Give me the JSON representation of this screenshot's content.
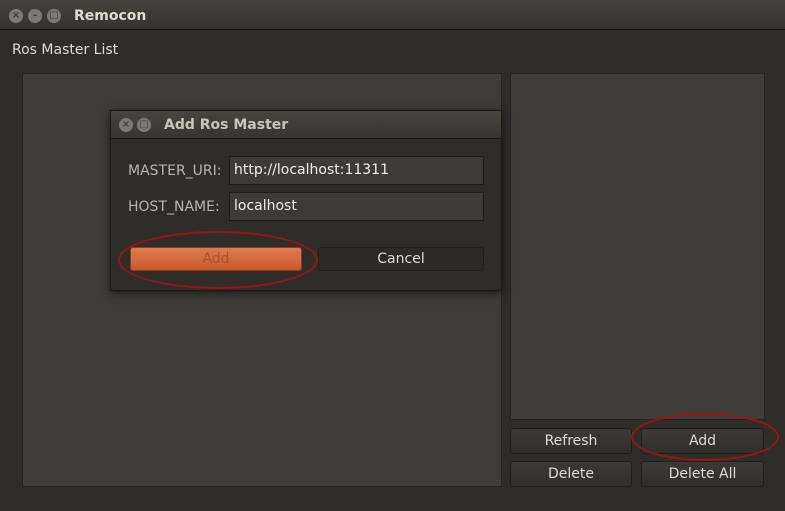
{
  "window": {
    "title": "Remocon",
    "controls": [
      "close-icon",
      "minimize-icon",
      "maximize-icon"
    ]
  },
  "main": {
    "section_label": "Ros Master List",
    "buttons": {
      "refresh": "Refresh",
      "add": "Add",
      "delete": "Delete",
      "delete_all": "Delete All"
    }
  },
  "dialog": {
    "title": "Add Ros Master",
    "controls": [
      "close-icon",
      "maximize-icon"
    ],
    "fields": [
      {
        "label": "MASTER_URI:",
        "value": "http://localhost:11311"
      },
      {
        "label": "HOST_NAME:",
        "value": "localhost"
      }
    ],
    "buttons": {
      "add": "Add",
      "cancel": "Cancel"
    }
  },
  "colors": {
    "accent": "#dd6b3f",
    "annotation": "#9a1414",
    "background": "#2e2d2a"
  }
}
